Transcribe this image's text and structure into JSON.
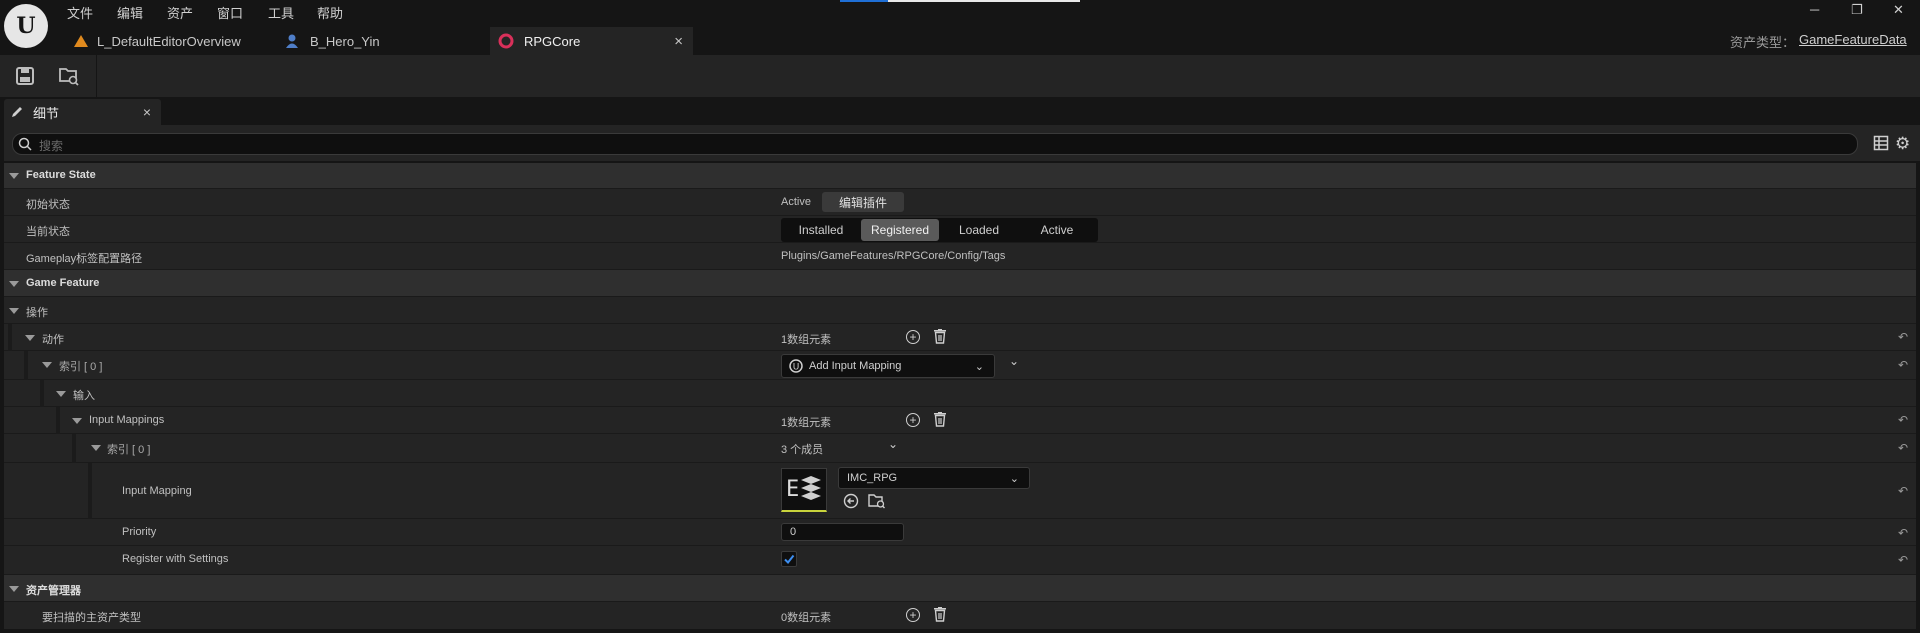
{
  "menu": [
    "文件",
    "编辑",
    "资产",
    "窗口",
    "工具",
    "帮助"
  ],
  "tabs": [
    {
      "label": "L_DefaultEditorOverview",
      "icon": "level-icon"
    },
    {
      "label": "B_Hero_Yin",
      "icon": "character-blueprint-icon"
    },
    {
      "label": "RPGCore",
      "icon": "game-feature-icon",
      "close": "×"
    }
  ],
  "asset_type": {
    "label": "资产类型：",
    "value": "GameFeatureData"
  },
  "window_controls": {
    "minimize": "─",
    "restore": "❐",
    "close": "✕"
  },
  "toolbar": {
    "save": "save-icon",
    "browse": "browse-to-asset-icon"
  },
  "details_panel": {
    "tab_label": "细节",
    "tab_close": "×",
    "search_placeholder": "搜索"
  },
  "sections": {
    "feature_state": {
      "title": "Feature State",
      "initial_state_label": "初始状态",
      "initial_state_value": "Active",
      "edit_plugin_button": "编辑插件",
      "current_state_label": "当前状态",
      "current_state_options": [
        "Installed",
        "Registered",
        "Loaded",
        "Active"
      ],
      "current_state_selected": "Registered",
      "tag_config_label": "Gameplay标签配置路径",
      "tag_config_value": "Plugins/GameFeatures/RPGCore/Config/Tags"
    },
    "game_feature": {
      "title": "Game Feature",
      "actions_group": "操作",
      "actions_label": "动作",
      "actions_count": "1数组元素",
      "index0_label": "索引 [ 0 ]",
      "index0_value": "Add Input Mapping",
      "input_label": "输入",
      "input_mappings_label": "Input Mappings",
      "input_mappings_count": "1数组元素",
      "mapping_index_label": "索引 [ 0 ]",
      "mapping_index_value": "3 个成员",
      "input_mapping_label": "Input Mapping",
      "input_mapping_value": "IMC_RPG",
      "input_mapping_thumb_letter": "E",
      "priority_label": "Priority",
      "priority_value": "0",
      "register_label": "Register with Settings",
      "register_checked": true
    },
    "asset_manager": {
      "title": "资产管理器",
      "primary_types_label": "要扫描的主资产类型",
      "primary_types_count": "0数组元素"
    }
  },
  "colors": {
    "accent_blue": "#1f6fd6",
    "feature_icon": "#d9305a",
    "selected_segment": "#5a5a5a"
  }
}
